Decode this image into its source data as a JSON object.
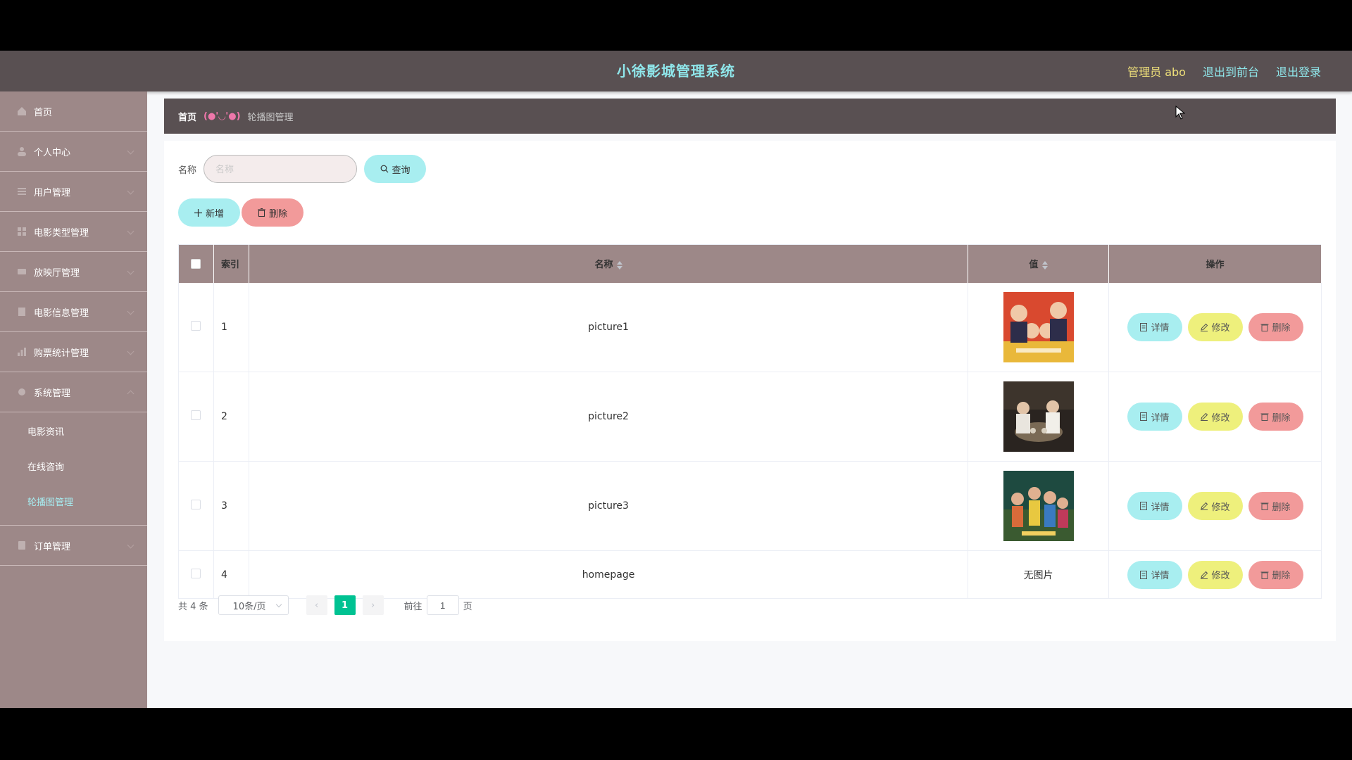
{
  "header": {
    "title": "小徐影城管理系统",
    "user_label": "管理员 abo",
    "to_front_label": "退出到前台",
    "logout_label": "退出登录"
  },
  "sidebar": {
    "items": [
      {
        "label": "首页",
        "icon": "home-icon"
      },
      {
        "label": "个人中心",
        "icon": "user-icon"
      },
      {
        "label": "用户管理",
        "icon": "users-icon"
      },
      {
        "label": "电影类型管理",
        "icon": "film-type-icon"
      },
      {
        "label": "放映厅管理",
        "icon": "hall-icon"
      },
      {
        "label": "电影信息管理",
        "icon": "film-info-icon"
      },
      {
        "label": "购票统计管理",
        "icon": "stats-icon"
      },
      {
        "label": "系统管理",
        "icon": "system-icon"
      }
    ],
    "system_sub": [
      {
        "label": "电影资讯"
      },
      {
        "label": "在线咨询"
      },
      {
        "label": "轮播图管理"
      }
    ],
    "orders": {
      "label": "订单管理",
      "icon": "order-icon"
    }
  },
  "breadcrumb": {
    "home": "首页",
    "separator": "(●'◡'●)",
    "current": "轮播图管理"
  },
  "search": {
    "label": "名称",
    "placeholder": "名称",
    "query_label": "查询"
  },
  "actions": {
    "add_label": "新增",
    "delete_label": "删除"
  },
  "table": {
    "headers": {
      "index": "索引",
      "name": "名称",
      "value": "值",
      "ops": "操作"
    },
    "rows": [
      {
        "index": "1",
        "name": "picture1",
        "value": "image",
        "value_text": ""
      },
      {
        "index": "2",
        "name": "picture2",
        "value": "image",
        "value_text": ""
      },
      {
        "index": "3",
        "name": "picture3",
        "value": "image",
        "value_text": ""
      },
      {
        "index": "4",
        "name": "homepage",
        "value": "none",
        "value_text": "无图片"
      }
    ],
    "ops": {
      "detail": "详情",
      "edit": "修改",
      "delete": "删除"
    }
  },
  "pager": {
    "total": "共 4 条",
    "page_size": "10条/页",
    "current_page": "1",
    "goto_label": "前往",
    "goto_value": "1",
    "page_suffix": "页"
  }
}
